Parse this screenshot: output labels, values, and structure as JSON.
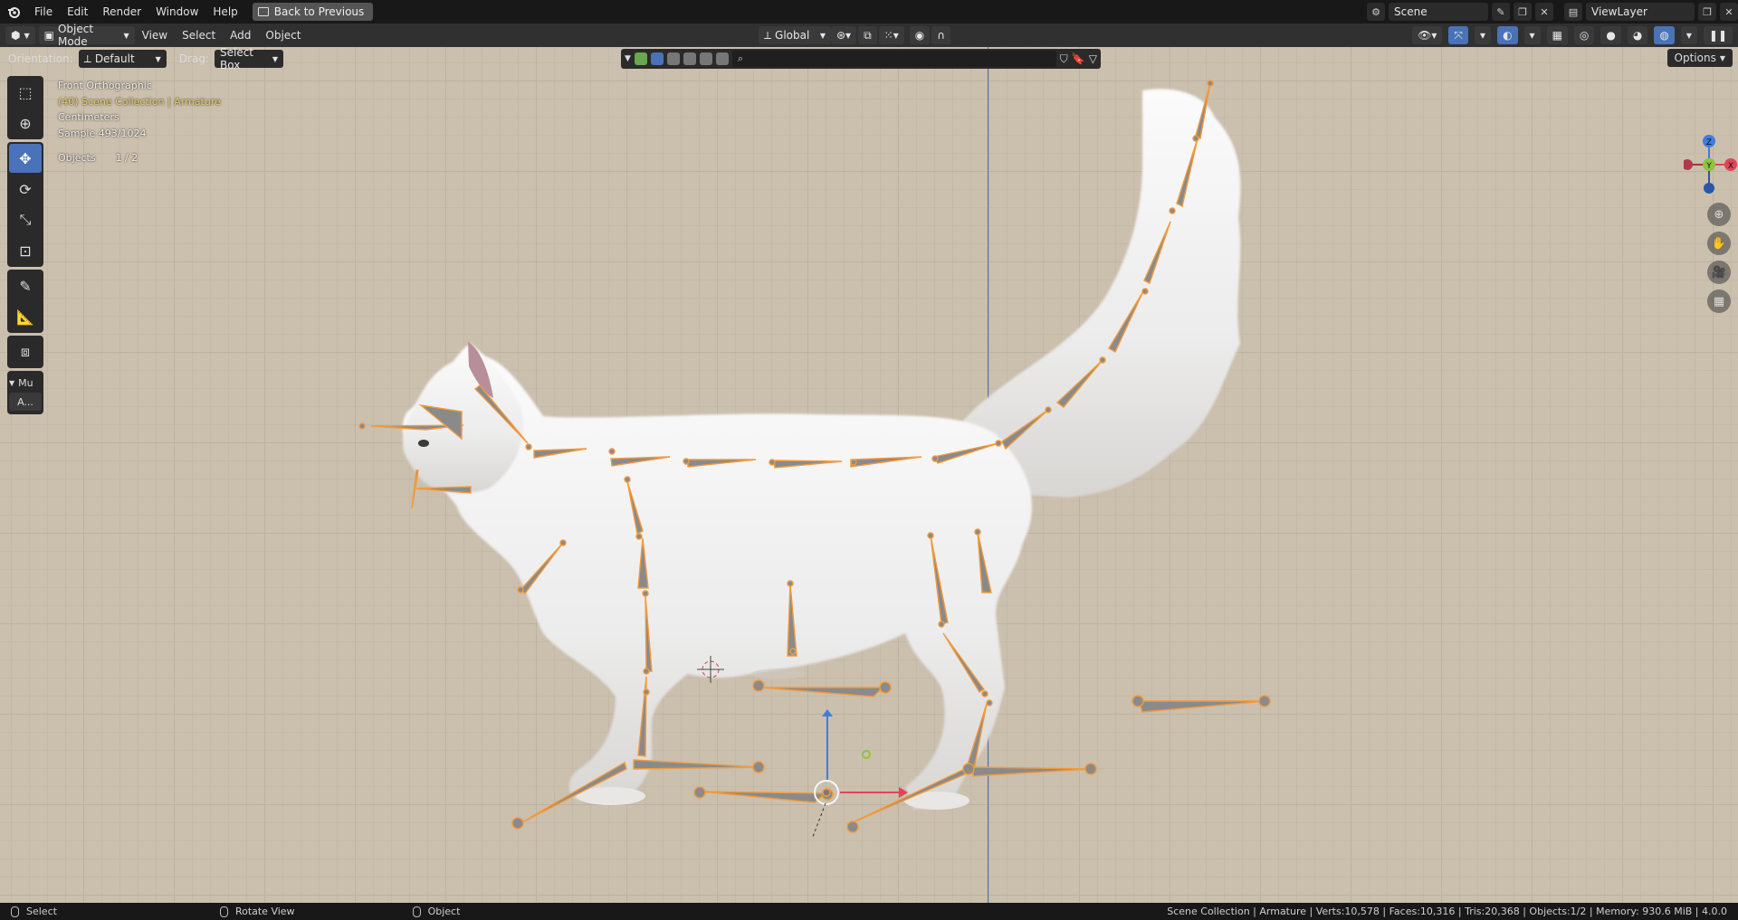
{
  "topbar": {
    "menus": [
      "File",
      "Edit",
      "Render",
      "Window",
      "Help"
    ],
    "back_label": "Back to Previous",
    "scene_name": "Scene",
    "view_layer": "ViewLayer"
  },
  "header": {
    "mode": "Object Mode",
    "menus": [
      "View",
      "Select",
      "Add",
      "Object"
    ],
    "transform_orientation": "Global"
  },
  "tool_settings": {
    "orientation_label": "Orientation:",
    "orientation_value": "Default",
    "drag_label": "Drag:",
    "drag_value": "Select Box",
    "options_label": "Options"
  },
  "viewport": {
    "view_name": "Front Orthographic",
    "collection_path": "(40) Scene Collection | Armature",
    "units": "Centimeters",
    "sample": "Sample 493/1024",
    "objects_label": "Objects",
    "objects_count": "1 / 2"
  },
  "toolbar": {
    "panel_label": "Mu",
    "panel_button": "A..."
  },
  "gizmo": {
    "z": "Z",
    "y": "Y",
    "x": "X"
  },
  "colors": {
    "axis_x": "#e0455a",
    "axis_y": "#8cc43c",
    "axis_z": "#3f7de0",
    "bone_outline": "#f09a3e",
    "bone_fill": "#8a8a8a"
  },
  "statusbar": {
    "select": "Select",
    "rotate": "Rotate View",
    "object": "Object",
    "stats": "Scene Collection | Armature | Verts:10,578 | Faces:10,316 | Tris:20,368 | Objects:1/2 | Memory: 930.6 MiB | 4.0.0"
  }
}
